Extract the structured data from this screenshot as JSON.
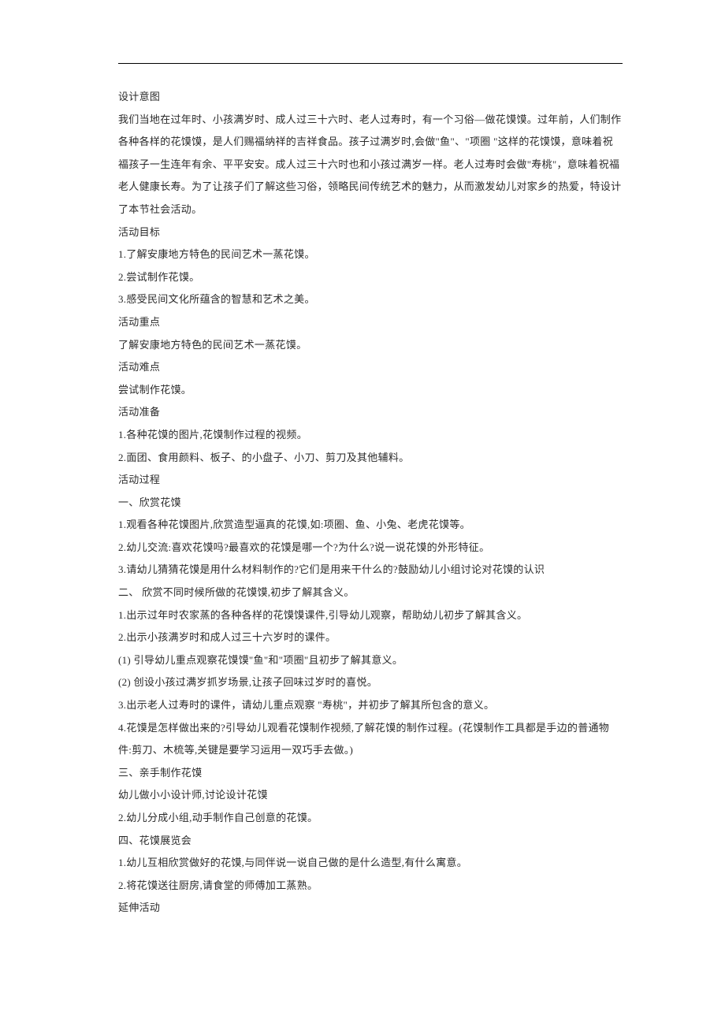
{
  "sections": {
    "design_intent": {
      "title": "设计意图",
      "body": "我们当地在过年时、小孩满岁时、成人过三十六时、老人过寿时，有一个习俗—做花馍馍。过年前，人们制作各种各样的花馍馍，是人们赐福纳祥的吉祥食品。孩子过满岁时,会做\"鱼\"、\"项圈 \"这样的花馍馍，意味着祝福孩子一生连年有余、平平安安。成人过三十六时也和小孩过满岁一样。老人过寿时会做\"寿桃\"，意味着祝福老人健康长寿。为了让孩子们了解这些习俗，领略民间传统艺术的魅力，从而激发幼儿对家乡的热爱，特设计了本节社会活动。"
    },
    "goals": {
      "title": "活动目标",
      "items": [
        "1.了解安康地方特色的民间艺术一蒸花馍。",
        "2.尝试制作花馍。",
        "3.感受民间文化所蕴含的智慧和艺术之美。"
      ]
    },
    "focus": {
      "title": "活动重点",
      "body": "了解安康地方特色的民间艺术一蒸花馍。"
    },
    "difficulty": {
      "title": "活动难点",
      "body": "尝试制作花馍。"
    },
    "preparation": {
      "title": "活动准备",
      "items": [
        "1.各种花馍的图片,花馍制作过程的视频。",
        "2.面团、食用颜料、板子、的小盘子、小刀、剪刀及其他辅料。"
      ]
    },
    "process": {
      "title": "活动过程",
      "part1": {
        "title": "一、欣赏花馍",
        "items": [
          "1.观看各种花馍图片,欣赏造型逼真的花馍,如:项圈、鱼、小兔、老虎花馍等。",
          "2.幼儿交流:喜欢花馍吗?最喜欢的花馍是哪一个?为什么?说一说花馍的外形特征。",
          "3.请幼儿猜猜花馍是用什么材料制作的?它们是用来干什么的?鼓励幼儿小组讨论对花馍的认识"
        ]
      },
      "part2": {
        "title": "二、 欣赏不同时候所做的花馍馍,初步了解其含义。",
        "items": [
          "1.出示过年时农家蒸的各种各样的花馍馍课件,引导幼儿观察，帮助幼儿初步了解其含义。",
          "2.出示小孩满岁时和成人过三十六岁时的课件。",
          "(1)  引导幼儿重点观察花馍馍\"鱼\"和\"项圈\"且初步了解其意义。",
          "(2)  创设小孩过满岁抓岁场景,让孩子回味过岁时的喜悦。",
          "3.出示老人过寿时的课件，请幼儿重点观察 \"寿桃\"，并初步了解其所包含的意义。",
          "4.花馍是怎样做出来的?引导幼儿观看花馍制作视频,了解花馍的制作过程。(花馍制作工具都是手边的普通物件:剪刀、木梳等,关键是要学习运用一双巧手去做。)"
        ]
      },
      "part3": {
        "title": "三、亲手制作花馍",
        "items": [
          "幼儿做小小设计师,讨论设计花馍",
          "2.幼儿分成小组,动手制作自己创意的花馍。"
        ]
      },
      "part4": {
        "title": "四、花馍展览会",
        "items": [
          "1.幼儿互相欣赏做好的花馍,与同伴说一说自己做的是什么造型,有什么寓意。",
          "2.将花馍送往厨房,请食堂的师傅加工蒸熟。"
        ]
      }
    },
    "extension": {
      "title": "延伸活动"
    }
  }
}
